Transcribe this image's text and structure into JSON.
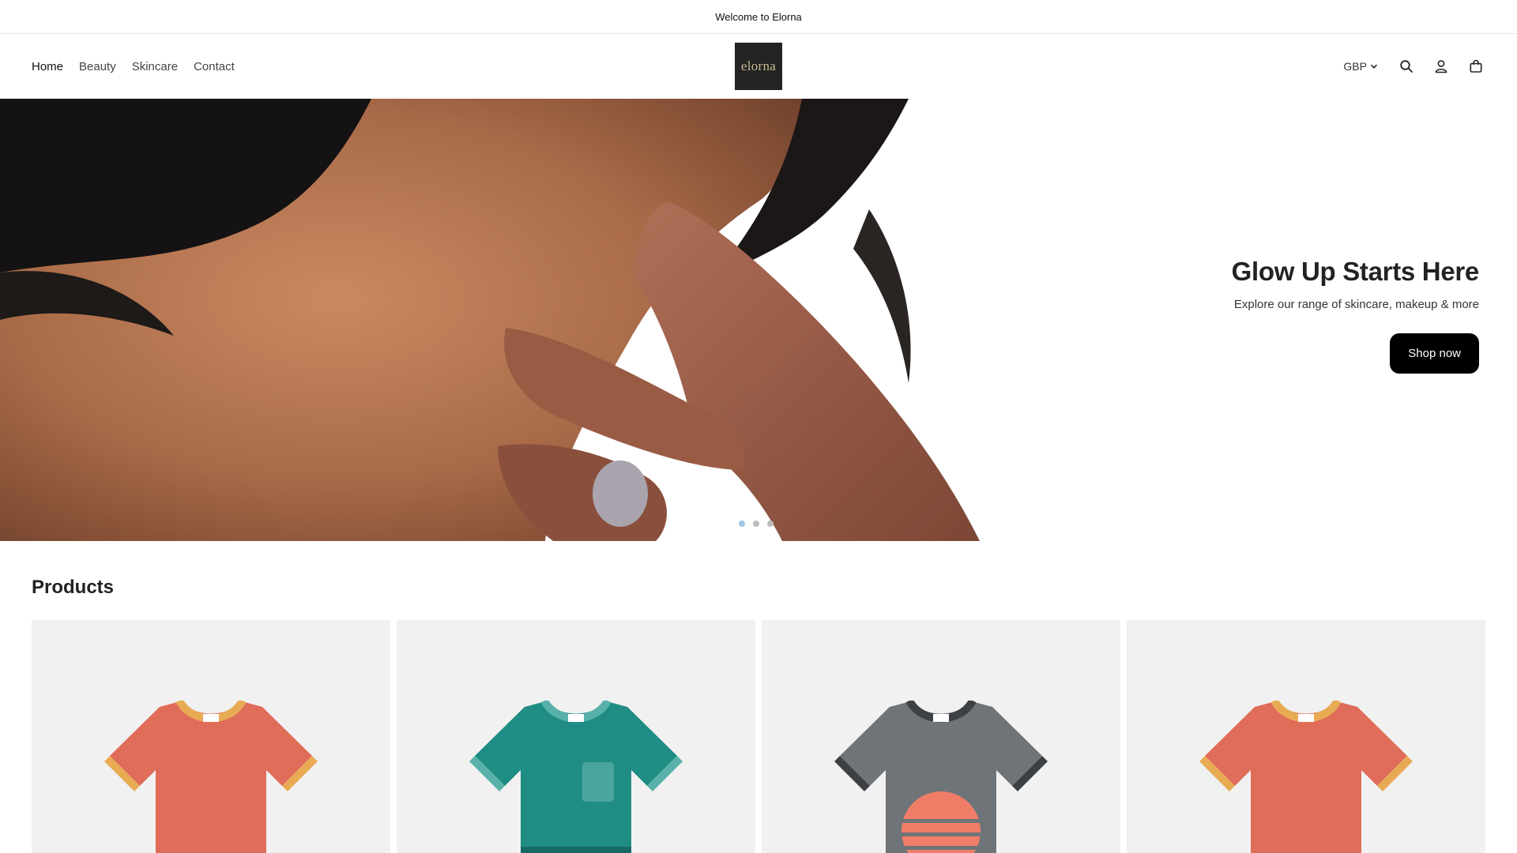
{
  "announcement": {
    "text": "Welcome to Elorna"
  },
  "header": {
    "nav": [
      {
        "label": "Home"
      },
      {
        "label": "Beauty"
      },
      {
        "label": "Skincare"
      },
      {
        "label": "Contact"
      }
    ],
    "logo_text": "elorna",
    "currency": "GBP",
    "icons": [
      "search-icon",
      "account-icon",
      "cart-icon"
    ]
  },
  "hero": {
    "title": "Glow Up Starts Here",
    "subtitle": "Explore our range of skincare, makeup & more",
    "button": "Shop now",
    "slides": 3,
    "active_slide": 1
  },
  "products": {
    "title": "Products",
    "items": [
      {
        "color": "#e06c5a",
        "trim": "#e8ab53"
      },
      {
        "color": "#1f8d84",
        "trim": "#58b2aa"
      },
      {
        "color": "#6f7479",
        "trim": "#3d4145"
      },
      {
        "color": "#e06c5a",
        "trim": "#e8ab53"
      }
    ]
  },
  "colors": {
    "button_bg": "#000000",
    "card_bg": "#f1f1f1",
    "logo_bg": "#232323"
  }
}
